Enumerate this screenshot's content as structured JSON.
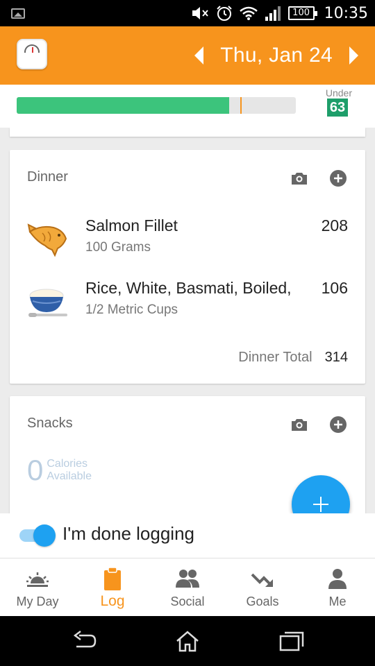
{
  "status_bar": {
    "battery": "100",
    "time": "10:35"
  },
  "header": {
    "date": "Thu, Jan 24",
    "icons": {
      "app": "scale-icon",
      "prev": "arrow-left-icon",
      "next": "arrow-right-icon"
    }
  },
  "budget": {
    "label": "Under",
    "value": "63",
    "progress": 0.76,
    "marker": 0.8,
    "fill_color": "#3cc47c",
    "marker_color": "#f7941d"
  },
  "dinner": {
    "title": "Dinner",
    "items": [
      {
        "name": "Salmon Fillet",
        "serving": "100 Grams",
        "calories": "208",
        "icon": "fish-icon"
      },
      {
        "name": "Rice, White, Basmati, Boiled, ",
        "serving": "1/2 Metric Cups",
        "calories": "106",
        "icon": "rice-bowl-icon"
      }
    ],
    "total_label": "Dinner Total",
    "total_value": "314"
  },
  "snacks": {
    "title": "Snacks",
    "calories_value": "0",
    "calories_label_1": "Calories",
    "calories_label_2": "Available"
  },
  "done_logging": {
    "label": "I'm done logging",
    "checked": true
  },
  "nav": {
    "items": [
      {
        "label": "My Day",
        "icon": "sunrise-icon"
      },
      {
        "label": "Log",
        "icon": "clipboard-icon"
      },
      {
        "label": "Social",
        "icon": "people-icon"
      },
      {
        "label": "Goals",
        "icon": "trend-down-icon"
      },
      {
        "label": "Me",
        "icon": "person-icon"
      }
    ],
    "active": "Log"
  },
  "colors": {
    "brand": "#f7941d",
    "accent": "#1ea1f1",
    "positive": "#1e9e6a"
  }
}
